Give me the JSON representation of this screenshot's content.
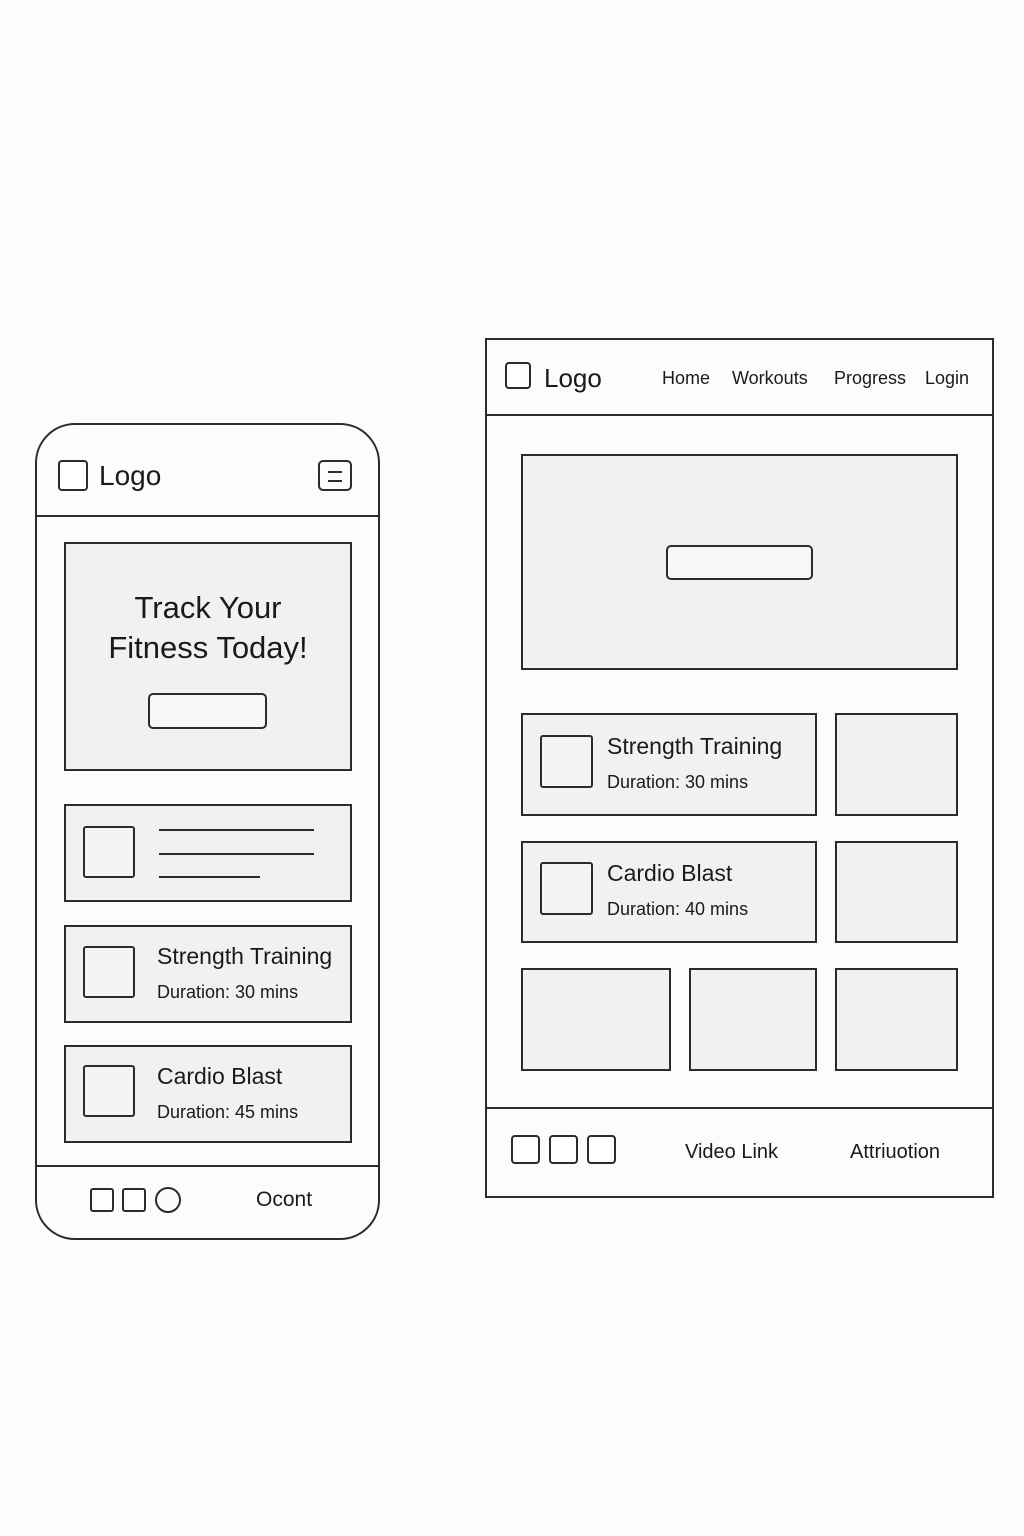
{
  "mobile": {
    "header": {
      "logo_text": "Logo",
      "menu_icon": "hamburger-menu-icon"
    },
    "hero": {
      "title_line1": "Track Your",
      "title_line2": "Fitness Today!",
      "button_label": ""
    },
    "cards": [
      {
        "title": "Strength Training",
        "duration": "Duration: 30 mins"
      },
      {
        "title": "Cardio Blast",
        "duration": "Duration: 45 mins"
      }
    ],
    "footer": {
      "text": "Ocont"
    }
  },
  "desktop": {
    "header": {
      "logo_text": "Logo",
      "nav": [
        "Home",
        "Workouts",
        "Progress",
        "Login"
      ]
    },
    "hero": {
      "button_label": ""
    },
    "cards": [
      {
        "title": "Strength Training",
        "duration": "Duration: 30 mins"
      },
      {
        "title": "Cardio Blast",
        "duration": "Duration: 40 mins"
      }
    ],
    "footer": {
      "video_link": "Video Link",
      "attribution": "Attriuotion"
    }
  },
  "colors": {
    "stroke": "#2b2b2b",
    "panel": "#f1f1f1",
    "background": "#fcfcfc"
  }
}
